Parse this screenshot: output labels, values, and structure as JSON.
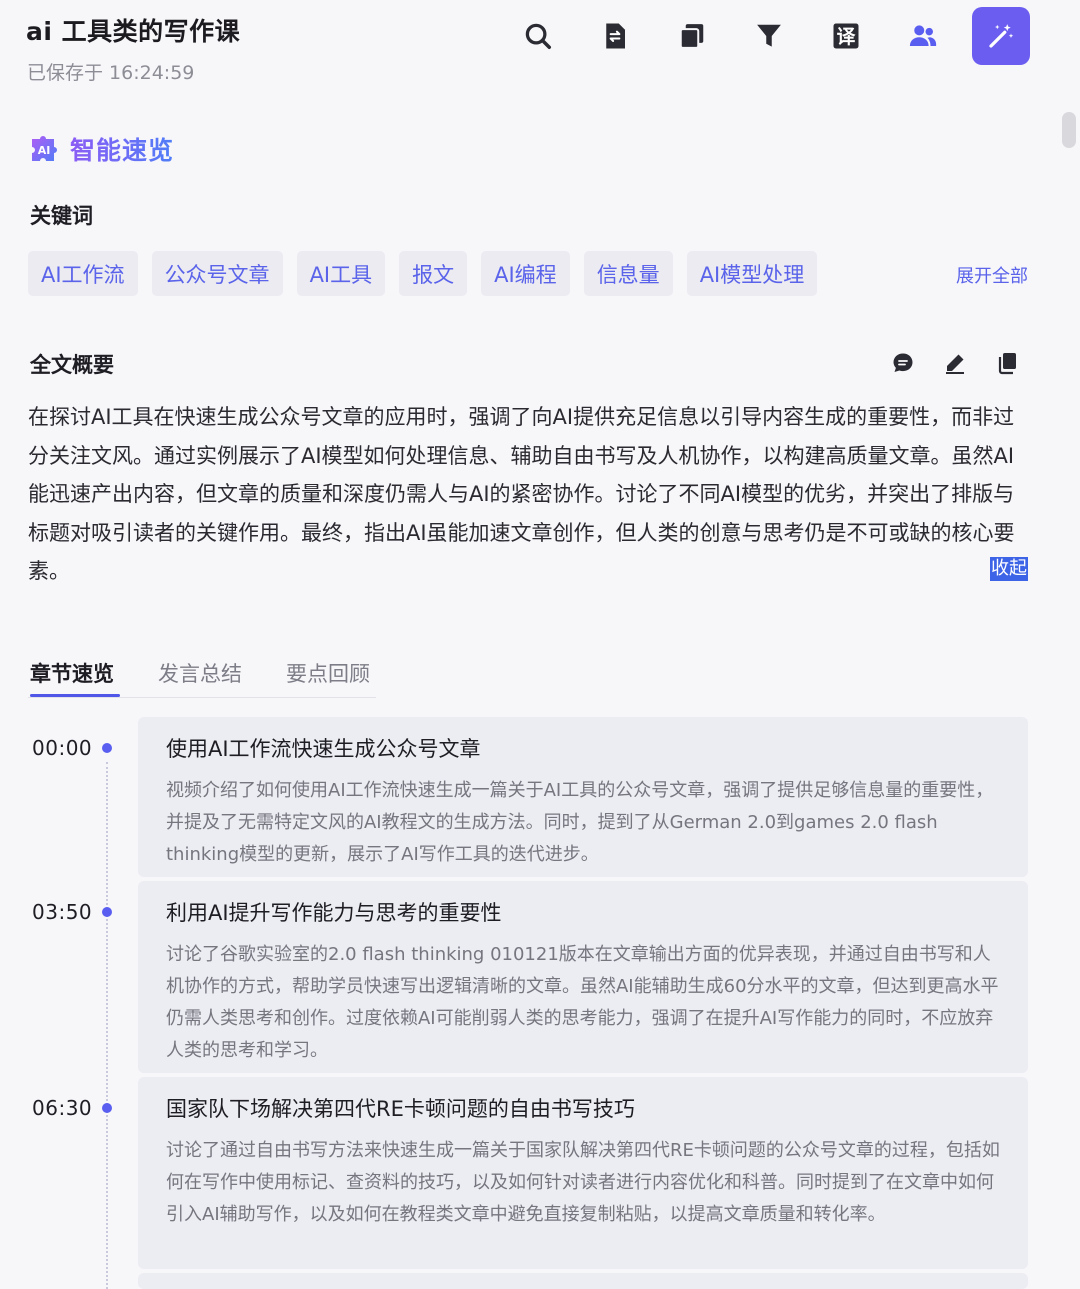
{
  "header": {
    "title": "ai 工具类的写作课",
    "saved_status": "已保存于 16:24:59"
  },
  "toolbar": {
    "buttons": [
      "search-icon",
      "file-convert-icon",
      "copy-stack-icon",
      "filter-icon",
      "translate-icon",
      "users-icon",
      "magic-wand-icon"
    ],
    "translate_glyph": "译",
    "accent_color": "#6b5df0"
  },
  "overview": {
    "title": "智能速览",
    "badge_text": "AI"
  },
  "keywords": {
    "label": "关键词",
    "tags": [
      "AI工作流",
      "公众号文章",
      "AI工具",
      "报文",
      "AI编程",
      "信息量",
      "AI模型处理"
    ],
    "expand_all": "展开全部"
  },
  "summary": {
    "label": "全文概要",
    "text": "在探讨AI工具在快速生成公众号文章的应用时，强调了向AI提供充足信息以引导内容生成的重要性，而非过分关注文风。通过实例展示了AI模型如何处理信息、辅助自由书写及人机协作，以构建高质量文章。虽然AI能迅速产出内容，但文章的质量和深度仍需人与AI的紧密协作。讨论了不同AI模型的优劣，并突出了排版与标题对吸引读者的关键作用。最终，指出AI虽能加速文章创作，但人类的创意与思考仍是不可或缺的核心要素。",
    "collapse": "收起"
  },
  "tabs": [
    "章节速览",
    "发言总结",
    "要点回顾"
  ],
  "chapters": [
    {
      "time": "00:00",
      "title": "使用AI工作流快速生成公众号文章",
      "body": "视频介绍了如何使用AI工作流快速生成一篇关于AI工具的公众号文章，强调了提供足够信息量的重要性，并提及了无需特定文风的AI教程文的生成方法。同时，提到了从German 2.0到games 2.0 flash thinking模型的更新，展示了AI写作工具的迭代进步。"
    },
    {
      "time": "03:50",
      "title": "利用AI提升写作能力与思考的重要性",
      "body": "讨论了谷歌实验室的2.0 flash thinking 010121版本在文章输出方面的优异表现，并通过自由书写和人机协作的方式，帮助学员快速写出逻辑清晰的文章。虽然AI能辅助生成60分水平的文章，但达到更高水平仍需人类思考和创作。过度依赖AI可能削弱人类的思考能力，强调了在提升AI写作能力的同时，不应放弃人类的思考和学习。"
    },
    {
      "time": "06:30",
      "title": "国家队下场解决第四代RE卡顿问题的自由书写技巧",
      "body": "讨论了通过自由书写方法来快速生成一篇关于国家队解决第四代RE卡顿问题的公众号文章的过程，包括如何在写作中使用标记、查资料的技巧，以及如何针对读者进行内容优化和科普。同时提到了在文章中如何引入AI辅助写作，以及如何在教程类文章中避免直接复制粘贴，以提高文章质量和转化率。"
    }
  ]
}
